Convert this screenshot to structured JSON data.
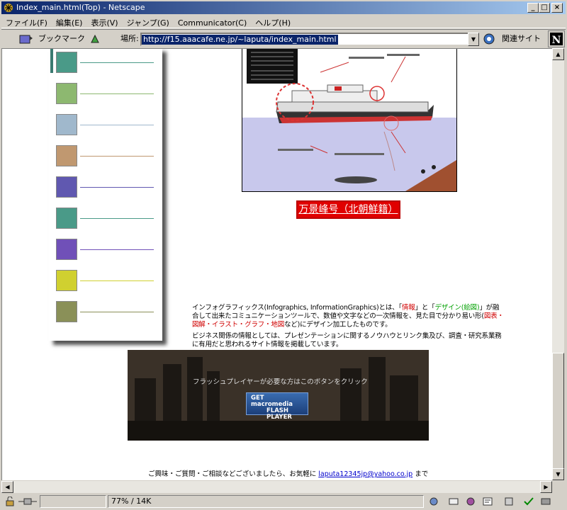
{
  "window": {
    "title": "Index_main.html(Top) - Netscape",
    "controls": [
      "_",
      "□",
      "×"
    ]
  },
  "menu": [
    "ファイル(F)",
    "編集(E)",
    "表示(V)",
    "ジャンプ(G)",
    "Communicator(C)",
    "ヘルプ(H)"
  ],
  "toolbar": {
    "bookmarks_label": "ブックマーク",
    "location_label": "場所:",
    "url": "http://f15.aaacafe.ne.jp/~laputa/index_main.html",
    "related_label": "関連サイト"
  },
  "sidebar": {
    "colors": [
      "#4a9a88",
      "#8db870",
      "#a0b8cc",
      "#c09870",
      "#6058b0",
      "#4a9a88",
      "#7050b8",
      "#d0d030",
      "#8a9058"
    ]
  },
  "main": {
    "ship_link": "万景峰号（北朝鮮籍）",
    "para1": {
      "a": "インフォグラフィックス(Infographics, InformationGraphics)とは、「",
      "b": "情報",
      "c": "」と「",
      "d": "デザイン(絵図)",
      "e": "」が融合して出来たコミュニケーションツールで、数値や文字などの一次情報を、見た目で分かり易い形(",
      "f": "図表・図解・イラスト・グラフ・地図",
      "g": "など)にデザイン加工したものです。"
    },
    "para2": "ビジネス関係の情報としては、プレゼンテーションに関するノウハウとリンク集及び、調査・研究系業務に有用だと思われるサイト情報を掲載しています。",
    "flash_caption": "フラッシュプレイヤーが必要な方はこのボタンをクリック",
    "flash_button": [
      "GET macromedia",
      "FLASH",
      "PLAYER"
    ],
    "footer_text": "ご興味・ご質問・ご相談などございましたら、お気軽に",
    "footer_email": "laputa12345jp@yahoo.co.jp",
    "footer_suffix": "まで"
  },
  "status": {
    "progress": "77% / 14K"
  }
}
